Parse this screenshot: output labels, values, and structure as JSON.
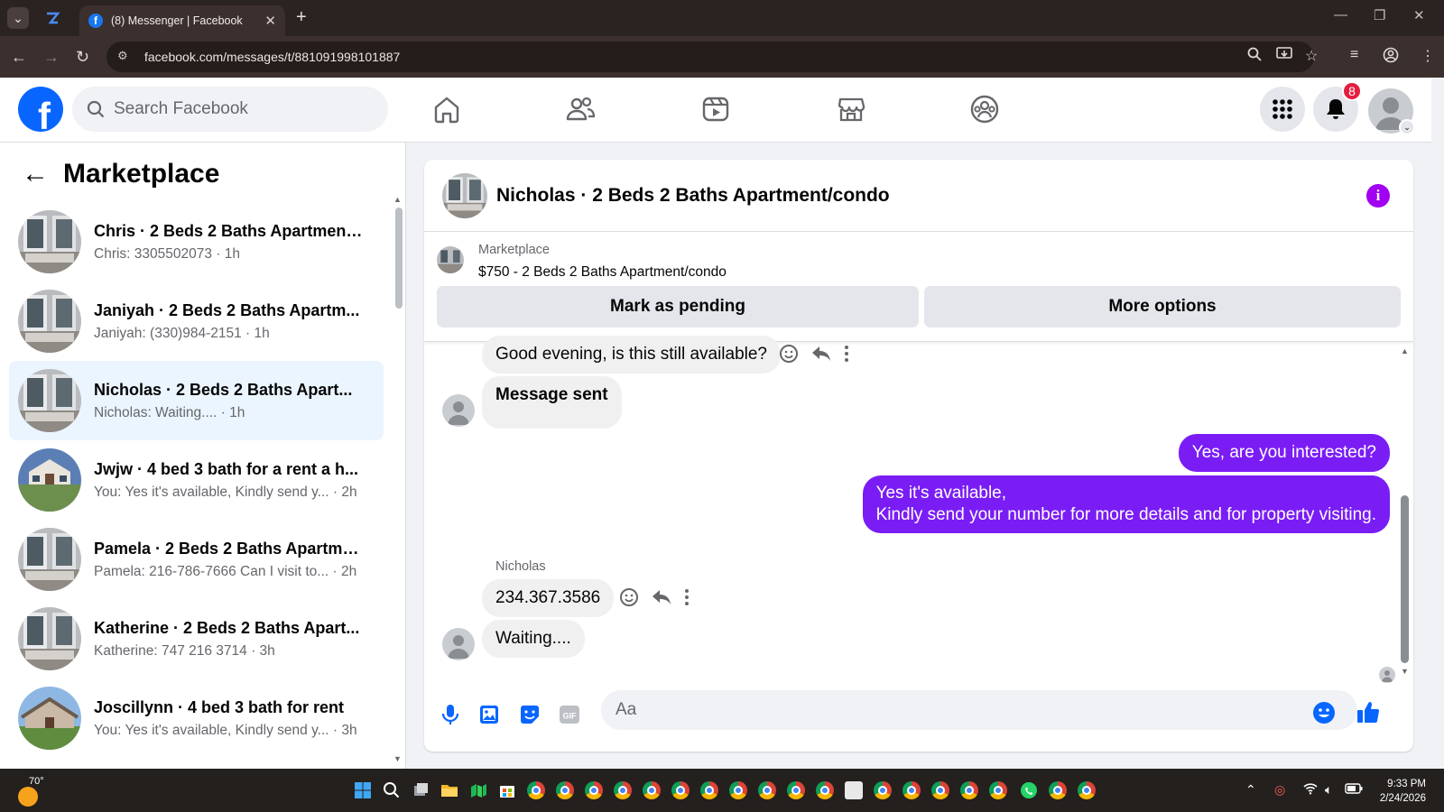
{
  "browser": {
    "tab_title": "(8) Messenger | Facebook",
    "url": "facebook.com/messages/t/881091998101887"
  },
  "fb": {
    "logo": "f",
    "search_placeholder": "Search Facebook",
    "notification_count": "8",
    "nav_icons": [
      "home-icon",
      "friends-icon",
      "watch-icon",
      "marketplace-icon",
      "groups-icon"
    ]
  },
  "sidebar": {
    "title": "Marketplace",
    "conversations": [
      {
        "name": "Chris · 2 Beds 2 Baths Apartment...",
        "snippet": "Chris: 3305502073 · 1h",
        "active": false
      },
      {
        "name": "Janiyah · 2 Beds 2 Baths Apartm...",
        "snippet": "Janiyah: (330)984-2151 · 1h",
        "active": false
      },
      {
        "name": "Nicholas · 2 Beds 2 Baths Apart...",
        "snippet": "Nicholas: Waiting.... · 1h",
        "active": true
      },
      {
        "name": "Jwjw · 4 bed 3 bath for a rent a h...",
        "snippet": "You: Yes it's available, Kindly send y... · 2h",
        "active": false
      },
      {
        "name": "Pamela · 2 Beds 2 Baths Apartme...",
        "snippet": "Pamela: 216-786-7666 Can I visit to... · 2h",
        "active": false
      },
      {
        "name": "Katherine · 2 Beds 2 Baths Apart...",
        "snippet": "Katherine: 747 216 3714 · 3h",
        "active": false
      },
      {
        "name": "Joscillynn · 4 bed 3 bath for rent",
        "snippet": "You: Yes it's available, Kindly send y... · 3h",
        "active": false
      }
    ]
  },
  "chat": {
    "title": "Nicholas · 2 Beds 2 Baths Apartment/condo",
    "listing_label": "Marketplace",
    "listing_price": "$750 - 2 Beds 2 Baths Apartment/condo",
    "mark_pending": "Mark as pending",
    "more_options": "More options",
    "messages": {
      "m1": "Good evening, is this still available?",
      "m2": "Message sent",
      "m3": "Yes, are you interested?",
      "m4a": "Yes it's available,",
      "m4b": "Kindly send your number for more details and for property visiting.",
      "sender": "Nicholas",
      "m5": "234.367.3586",
      "m6": "Waiting...."
    },
    "composer_placeholder": "Aa"
  },
  "taskbar": {
    "temperature": "70°",
    "time": "9:33 PM",
    "date": "2/24/2026"
  },
  "colors": {
    "fb_blue": "#0866ff",
    "outgoing_bubble": "#7a1df5",
    "info_purple": "#a100f2"
  }
}
